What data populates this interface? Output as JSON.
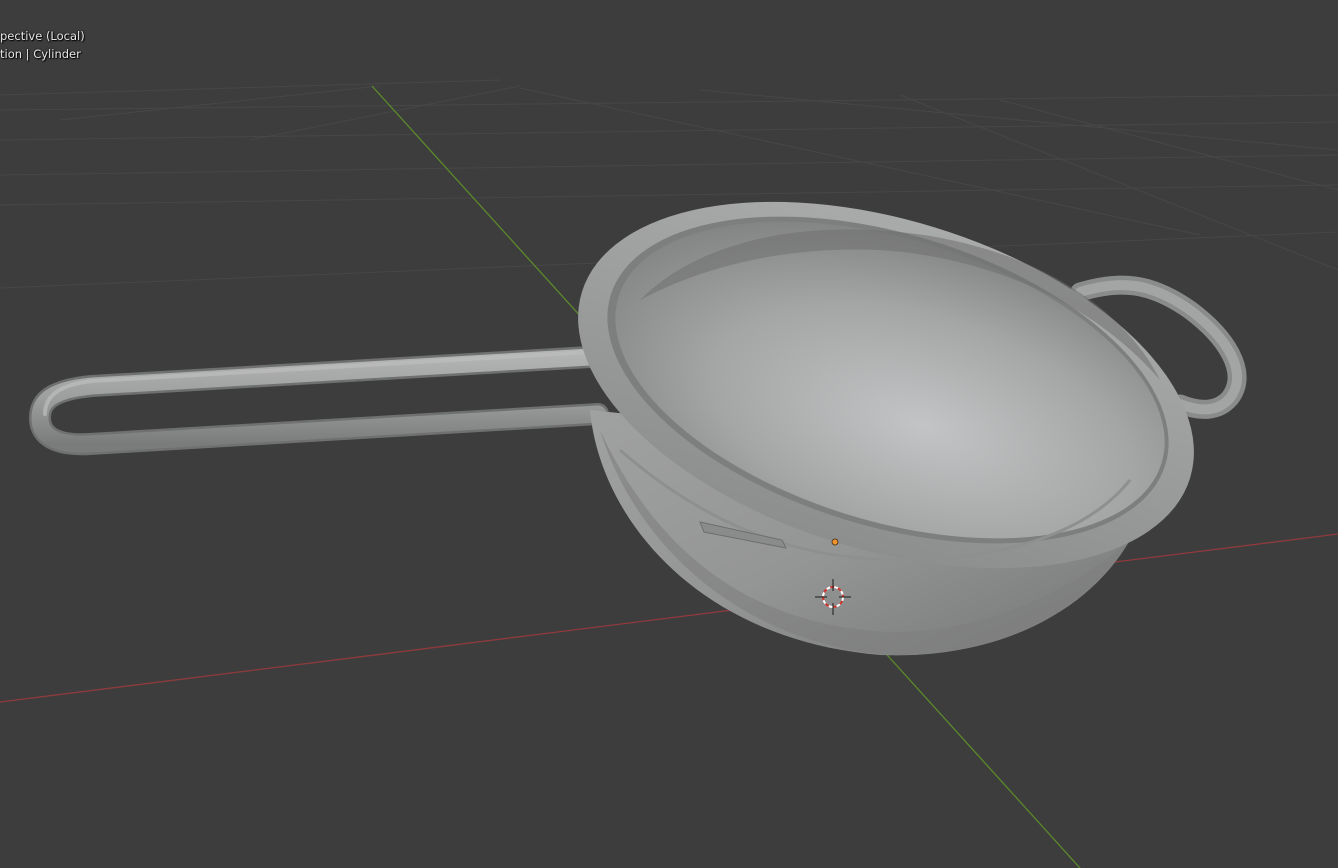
{
  "viewport": {
    "view_name": "pective (Local)",
    "view_context": "tion | Cylinder"
  },
  "colors": {
    "background": "#3d3d3d",
    "grid_line": "#4a4a4a",
    "x_axis": "#9a3b3e",
    "y_axis": "#5f8a2c",
    "mesh": "#9a9b9b",
    "origin_point": "#f0932f"
  },
  "scene_objects": {
    "mesh_name": "Cylinder",
    "mesh_description": "strainer-bowl-with-handle",
    "origin_marker_icon": "origin-dot-icon",
    "cursor_icon": "3d-cursor-icon"
  }
}
